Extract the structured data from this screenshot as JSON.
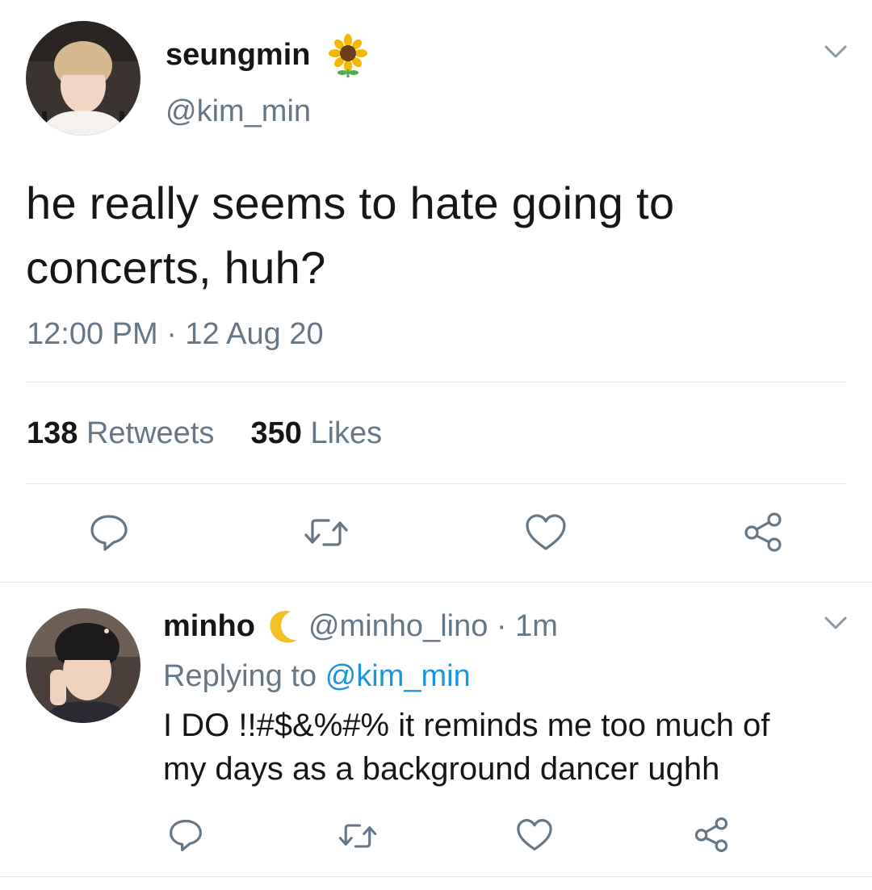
{
  "main_tweet": {
    "author_name": "seungmin",
    "author_emoji": "sunflower-emoji",
    "handle": "@kim_min",
    "text_line1": "he really seems to hate going to",
    "text_line2": "concerts, huh?",
    "timestamp": "12:00 PM · 12 Aug 20",
    "retweet_count": "138",
    "retweet_label": "Retweets",
    "like_count": "350",
    "like_label": "Likes"
  },
  "reply": {
    "author_name": "minho",
    "author_emoji": "crescent-moon-emoji",
    "handle_time": "@minho_lino · 1m",
    "replying_prefix": "Replying to",
    "replying_handle": "@kim_min",
    "text_line1": "I DO !!#$&%#% it reminds me too much of",
    "text_line2": "my days as a background dancer ughh"
  },
  "icons": [
    "reply-icon",
    "retweet-icon",
    "like-icon",
    "share-icon",
    "chevron-down-icon"
  ],
  "colors": {
    "text": "#14171a",
    "muted": "#657786",
    "link": "#1b95e0",
    "divider": "#e1e8ed"
  }
}
